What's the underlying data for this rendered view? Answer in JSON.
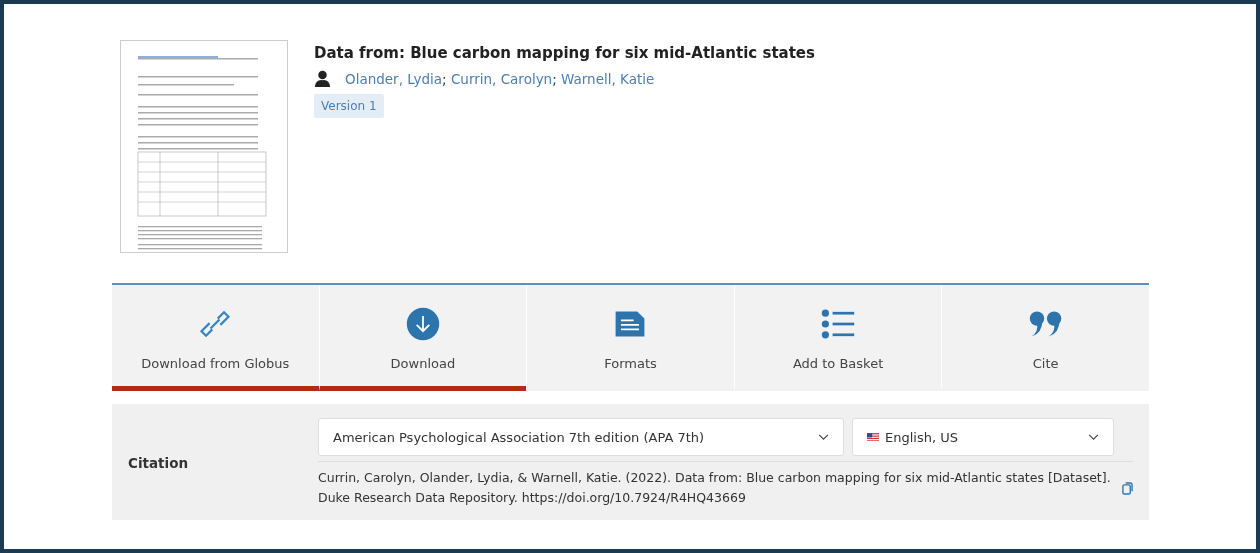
{
  "record": {
    "title": "Data from: Blue carbon mapping for six mid-Atlantic states",
    "authors": [
      {
        "name": "Olander, Lydia"
      },
      {
        "name": "Currin, Carolyn"
      },
      {
        "name": "Warnell, Katie"
      }
    ],
    "author_separator": ";",
    "version": "Version 1"
  },
  "actions": [
    {
      "label": "Download from Globus",
      "kind": "link",
      "selected": true
    },
    {
      "label": "Download",
      "kind": "download",
      "selected": true
    },
    {
      "label": "Formats",
      "kind": "document",
      "selected": false
    },
    {
      "label": "Add to Basket",
      "kind": "list",
      "selected": false
    },
    {
      "label": "Cite",
      "kind": "quote",
      "selected": false
    }
  ],
  "citation": {
    "label": "Citation",
    "style": "American Psychological Association 7th edition (APA 7th)",
    "language": "English, US",
    "text": "Currin, Carolyn, Olander, Lydia, & Warnell, Katie. (2022). Data from: Blue carbon mapping for six mid-Atlantic states [Dataset]. Duke Research Data Repository. https://doi.org/10.7924/R4HQ43669"
  }
}
